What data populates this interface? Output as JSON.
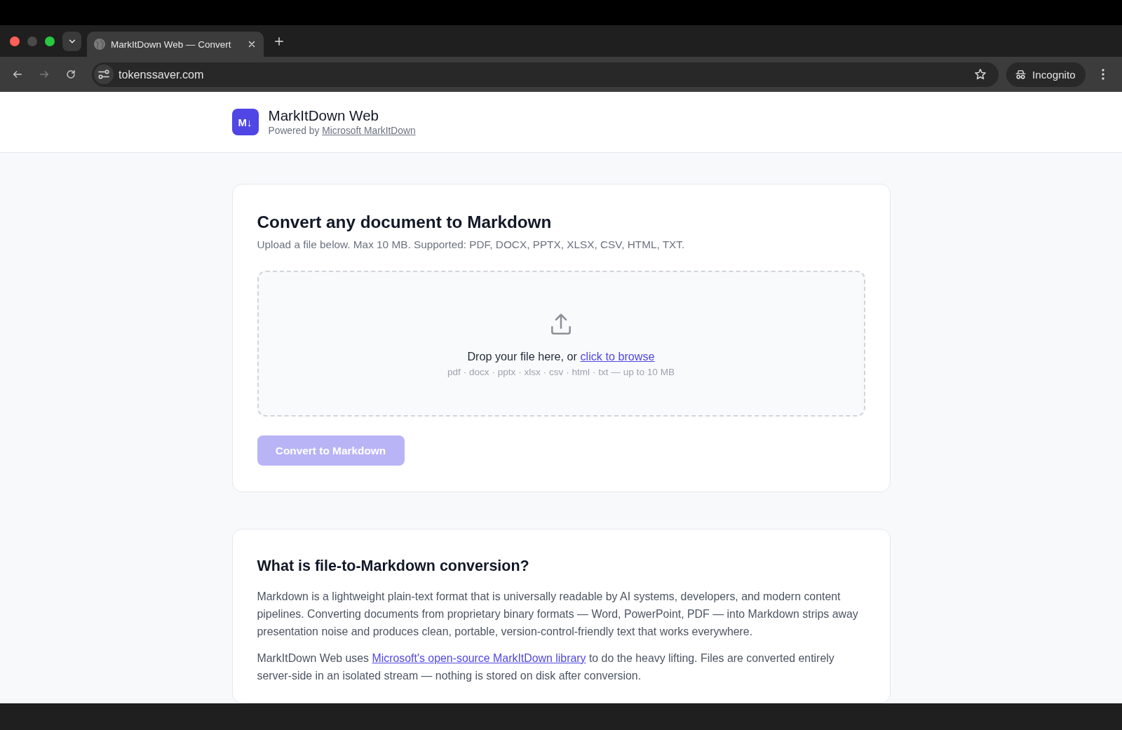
{
  "browser": {
    "tabs": [
      {
        "title": "MarkItDown Web — Convert",
        "selected": true
      }
    ],
    "nav_buttons": [
      {
        "kind": "back",
        "disabled": false
      },
      {
        "kind": "forward",
        "disabled": true
      },
      {
        "kind": "reload",
        "disabled": false
      }
    ],
    "address": "tokenssaver.com",
    "profile": "Incognito"
  },
  "header": {
    "logo": "M↓",
    "title": "MarkItDown Web",
    "tagline": "Powered by ",
    "tagline_link": "Microsoft MarkItDown"
  },
  "converter": {
    "title": "Convert any document to Markdown",
    "description": "Upload a file below. Max 10 MB. Supported: PDF, DOCX, PPTX, XLSX, CSV, HTML, TXT.",
    "dropzone": {
      "prompt": "Drop your file here, or ",
      "link": "click to browse",
      "hint": "pdf · docx · pptx · xlsx · csv · html · txt — up to 10 MB"
    },
    "button": {
      "label": "Convert to Markdown",
      "disabled": true
    }
  },
  "about": {
    "title": "What is file-to-Markdown conversion?",
    "paragraphs": [
      {
        "kind": "plain",
        "text": "Markdown is a lightweight plain-text format that is universally readable by AI systems, developers, and modern content pipelines. Converting documents from proprietary binary formats — Word, PowerPoint, PDF — into Markdown strips away presentation noise and produces clean, portable, version-control-friendly text that works everywhere."
      },
      {
        "kind": "linked",
        "before": "MarkItDown Web uses ",
        "link": "Microsoft's open-source MarkItDown library",
        "after": " to do the heavy lifting. Files are converted entirely server-side in an isolated stream — nothing is stored on disk after conversion."
      }
    ]
  }
}
